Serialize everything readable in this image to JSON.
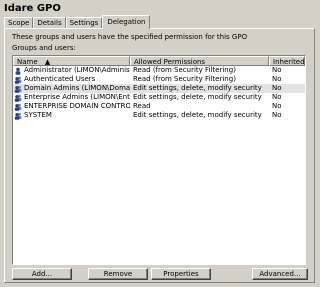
{
  "window": {
    "title": "Idare GPO"
  },
  "tabs": [
    {
      "label": "Scope"
    },
    {
      "label": "Details"
    },
    {
      "label": "Settings"
    },
    {
      "label": "Delegation"
    }
  ],
  "delegation": {
    "description": "These groups and users have the specified permission for this GPO",
    "list_label": "Groups and users:",
    "columns": [
      "Name",
      "Allowed Permissions",
      "Inherited"
    ],
    "rows": [
      {
        "name": "Administrator (LIMON\\Administrator)",
        "permission": "Read (from Security Filtering)",
        "inherited": "No",
        "icon": "user-icon"
      },
      {
        "name": "Authenticated Users",
        "permission": "Read (from Security Filtering)",
        "inherited": "No",
        "icon": "group-icon"
      },
      {
        "name": "Domain Admins (LIMON\\Domain Ad...",
        "permission": "Edit settings, delete, modify security",
        "inherited": "No",
        "icon": "group-icon"
      },
      {
        "name": "Enterprise Admins (LIMON\\Enterpris...",
        "permission": "Edit settings, delete, modify security",
        "inherited": "No",
        "icon": "group-icon"
      },
      {
        "name": "ENTERPRISE DOMAIN CONTROL...",
        "permission": "Read",
        "inherited": "No",
        "icon": "group-icon"
      },
      {
        "name": "SYSTEM",
        "permission": "Edit settings, delete, modify security",
        "inherited": "No",
        "icon": "group-icon"
      }
    ]
  },
  "buttons": {
    "add": "Add...",
    "remove": "Remove",
    "properties": "Properties",
    "advanced": "Advanced..."
  },
  "colors": {
    "selected_row": "#e3e3e3",
    "background": "#d4d0c8"
  }
}
